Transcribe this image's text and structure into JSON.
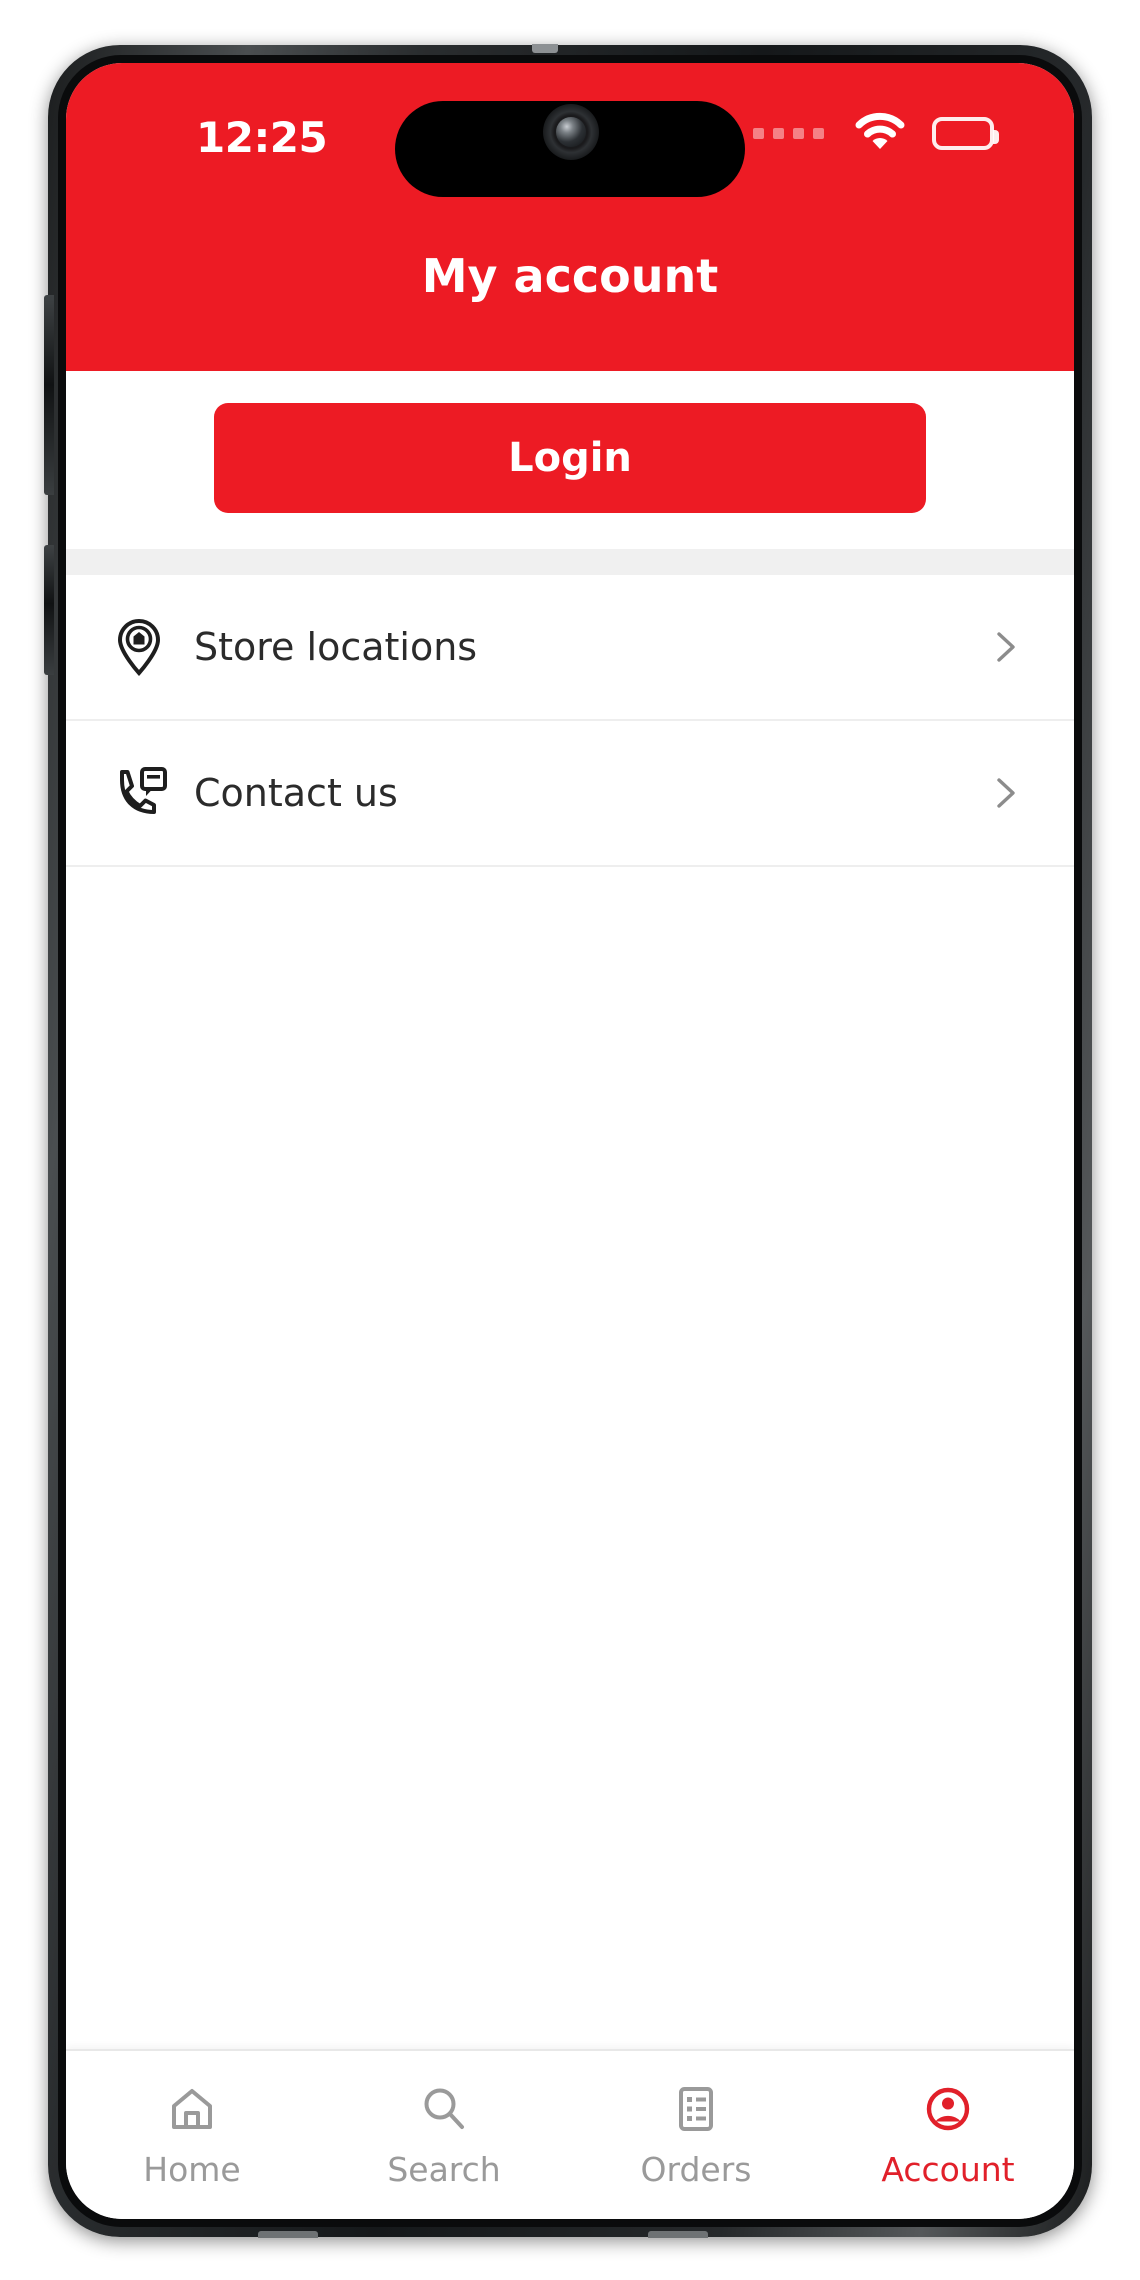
{
  "colors": {
    "brand_red": "#ed1b24",
    "accent_red": "#e1202a",
    "inactive_gray": "#9a9a9a",
    "text_dark": "#2b2b2b",
    "divider": "#f0f0f0"
  },
  "status_bar": {
    "time": "12:25",
    "signal_icon": "signal-dots-icon",
    "wifi_icon": "wifi-icon",
    "battery_icon": "battery-full-icon"
  },
  "header": {
    "title": "My account"
  },
  "login": {
    "label": "Login"
  },
  "menu": {
    "items": [
      {
        "label": "Store locations",
        "icon": "map-pin-store-icon",
        "chevron": "chevron-right-icon"
      },
      {
        "label": "Contact us",
        "icon": "phone-message-icon",
        "chevron": "chevron-right-icon"
      }
    ]
  },
  "bottom_nav": {
    "items": [
      {
        "label": "Home",
        "icon": "home-icon",
        "active": false
      },
      {
        "label": "Search",
        "icon": "search-icon",
        "active": false
      },
      {
        "label": "Orders",
        "icon": "orders-list-icon",
        "active": false
      },
      {
        "label": "Account",
        "icon": "account-person-icon",
        "active": true
      }
    ]
  }
}
